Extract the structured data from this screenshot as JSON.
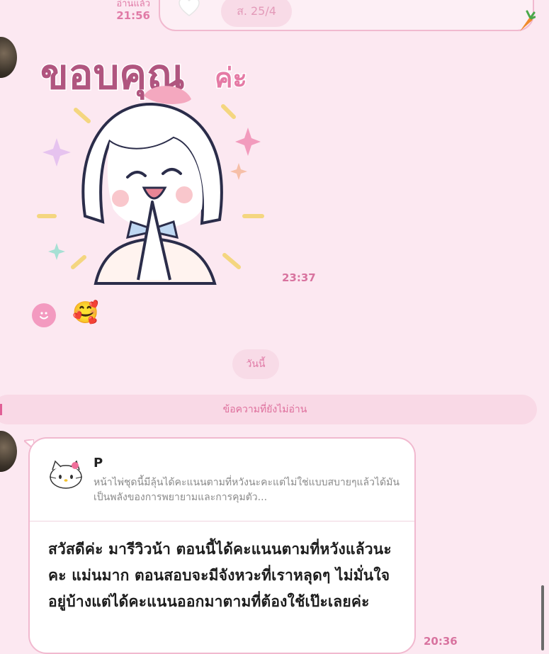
{
  "top_message": {
    "read_status": "อ่านแล้ว",
    "time": "21:56",
    "date_label": "ส. 25/4"
  },
  "sticker_message": {
    "sticker_text_main": "ขอบคุณ",
    "sticker_text_suffix": "ค่ะ",
    "time": "23:37",
    "reaction_emoji": "🥰"
  },
  "separators": {
    "today": "วันนี้",
    "unread": "ข้อความที่ยังไม่อ่าน"
  },
  "reply_message": {
    "quoted_name": "P",
    "quoted_text": "หน้าไพ่ชุดนี้มีลุ้นได้คะแนนตามที่หวังนะคะแต่ไม่ใช่แบบสบายๆแล้วได้มันเป็นพลังของการพยายามและการคุมตัว...",
    "text": "สวัสดีค่ะ มารีวิวน้า ตอนนี้ได้คะแนนตามที่หวังแล้วนะคะ แม่นมาก ตอนสอบจะมีจังหวะที่เราหลุดๆ ไม่มั่นใจอยู่บ้างแต่ได้คะแนนออกมาตามที่ต้องใช้เป๊ะเลยค่ะ",
    "time": "20:36"
  },
  "colors": {
    "background": "#fce8f1",
    "accent": "#e07aa6",
    "bubble_border": "#f1b9cf"
  },
  "icons": [
    "heart-icon",
    "carrot-icon",
    "reaction-button-icon",
    "hello-kitty-avatar-icon"
  ]
}
